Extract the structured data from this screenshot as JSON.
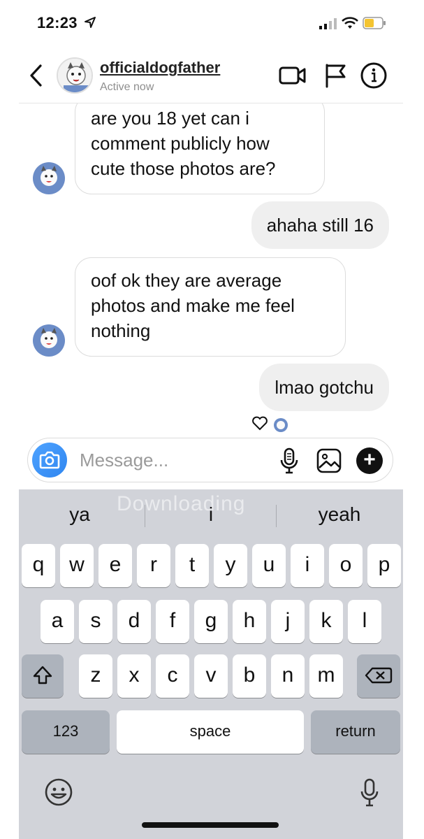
{
  "status_bar": {
    "time": "12:23"
  },
  "header": {
    "username": "officialdogfather",
    "status": "Active now"
  },
  "messages": [
    {
      "direction": "incoming",
      "text": "are you 18 yet can i comment publicly how cute those photos are?",
      "lines": [
        "are you 18 yet can i",
        "comment publicly how",
        "cute those photos are?"
      ]
    },
    {
      "direction": "outgoing",
      "text": "ahaha still 16"
    },
    {
      "direction": "incoming",
      "text": "oof ok they are average photos and make me feel nothing",
      "lines": [
        "oof ok they are average",
        "photos and make me feel",
        "nothing"
      ]
    },
    {
      "direction": "outgoing",
      "text": "lmao gotchu"
    }
  ],
  "composer": {
    "placeholder": "Message..."
  },
  "keyboard": {
    "suggestions": [
      "ya",
      "i",
      "yeah"
    ],
    "watermark": "Downloading",
    "row1": [
      "q",
      "w",
      "e",
      "r",
      "t",
      "y",
      "u",
      "i",
      "o",
      "p"
    ],
    "row2": [
      "a",
      "s",
      "d",
      "f",
      "g",
      "h",
      "j",
      "k",
      "l"
    ],
    "row3": [
      "z",
      "x",
      "c",
      "v",
      "b",
      "n",
      "m"
    ],
    "numbers_label": "123",
    "space_label": "space",
    "return_label": "return"
  },
  "colors": {
    "incoming_bubble_border": "#dcdcdc",
    "outgoing_bubble": "#efefef",
    "keyboard_bg": "#d1d3d9",
    "camera_button": "#2f86f0"
  }
}
